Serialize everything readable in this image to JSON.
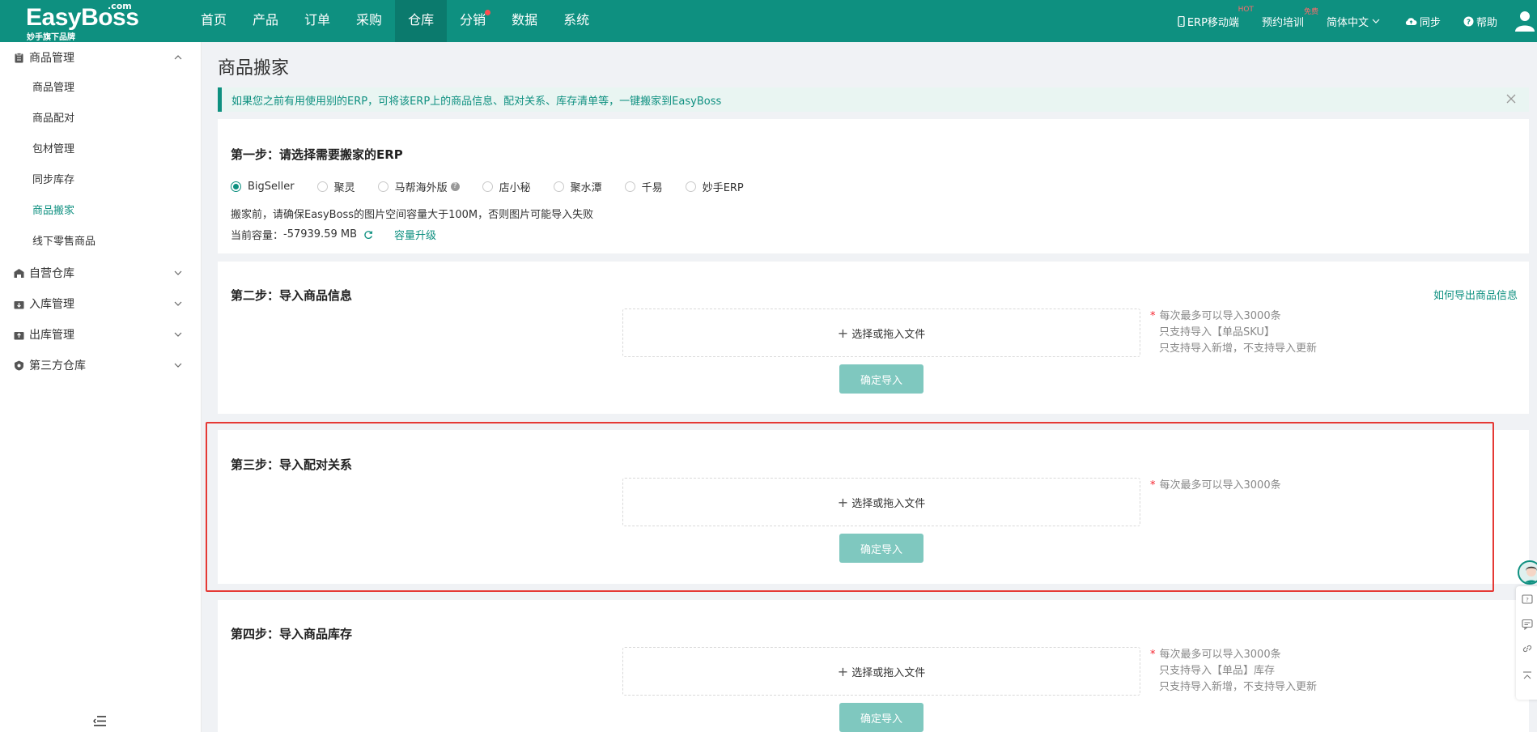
{
  "brand": {
    "name": "EasyBoss",
    "com": ".com",
    "tagline": "妙手旗下品牌"
  },
  "nav": {
    "items": [
      {
        "label": "首页"
      },
      {
        "label": "产品"
      },
      {
        "label": "订单"
      },
      {
        "label": "采购"
      },
      {
        "label": "仓库"
      },
      {
        "label": "分销"
      },
      {
        "label": "数据"
      },
      {
        "label": "系统"
      }
    ],
    "active": "仓库",
    "right": {
      "mobile": "ERP移动端",
      "mobile_badge": "HOT",
      "training": "预约培训",
      "training_badge": "免费",
      "language": "简体中文",
      "sync": "同步",
      "help": "帮助"
    }
  },
  "sidebar": {
    "groups": [
      {
        "label": "商品管理",
        "expanded": true,
        "items": [
          {
            "label": "商品管理"
          },
          {
            "label": "商品配对"
          },
          {
            "label": "包材管理"
          },
          {
            "label": "同步库存"
          },
          {
            "label": "商品搬家",
            "active": true
          },
          {
            "label": "线下零售商品"
          }
        ]
      },
      {
        "label": "自营仓库",
        "expanded": false
      },
      {
        "label": "入库管理",
        "expanded": false
      },
      {
        "label": "出库管理",
        "expanded": false
      },
      {
        "label": "第三方仓库",
        "expanded": false
      }
    ]
  },
  "page": {
    "title": "商品搬家",
    "alert": "如果您之前有用使用别的ERP，可将该ERP上的商品信息、配对关系、库存清单等，一键搬家到EasyBoss",
    "step1": {
      "title": "第一步：请选择需要搬家的ERP",
      "options": [
        "BigSeller",
        "聚灵",
        "马帮海外版",
        "店小秘",
        "聚水潭",
        "千易",
        "妙手ERP"
      ],
      "selected": "BigSeller",
      "note": "搬家前，请确保EasyBoss的图片空间容量大于100M，否则图片可能导入失败",
      "capacity_label": "当前容量：",
      "capacity_value": "-57939.59 MB",
      "upgrade": "容量升级"
    },
    "step2": {
      "title": "第二步：导入商品信息",
      "link": "如何导出商品信息",
      "upload": "选择或拖入文件",
      "confirm": "确定导入",
      "tips": [
        "每次最多可以导入3000条",
        "只支持导入【单品SKU】",
        "只支持导入新增，不支持导入更新"
      ]
    },
    "step3": {
      "title": "第三步：导入配对关系",
      "upload": "选择或拖入文件",
      "confirm": "确定导入",
      "tips": [
        "每次最多可以导入3000条"
      ]
    },
    "step4": {
      "title": "第四步：导入商品库存",
      "upload": "选择或拖入文件",
      "confirm": "确定导入",
      "tips": [
        "每次最多可以导入3000条",
        "只支持导入【单品】库存",
        "只支持导入新增，不支持导入更新"
      ]
    }
  },
  "colors": {
    "primary": "#0e9080",
    "highlight": "#e53935",
    "button_disabled": "#7fc8bf"
  }
}
